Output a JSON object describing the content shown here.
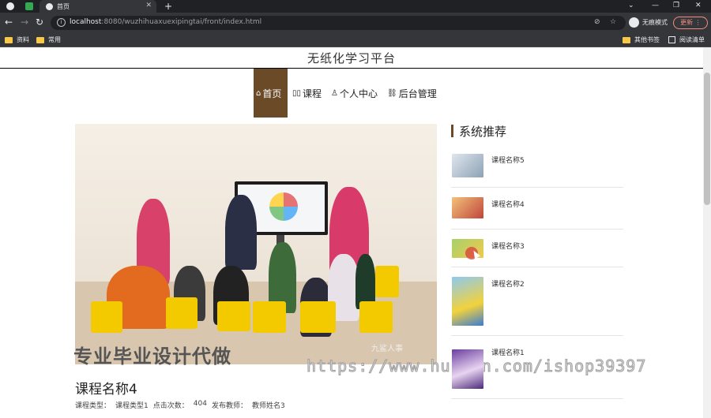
{
  "browser": {
    "tab_title": "首页",
    "url_host": "localhost",
    "url_rest": ":8080/wuzhihuaxuexipingtai/front/index.html",
    "profile_label": "无痕模式",
    "update_label": "更新",
    "bookmarks": [
      "资料",
      "常用"
    ],
    "other_bookmarks": "其他书签",
    "reading_list": "阅读清单"
  },
  "site": {
    "title": "无纸化学习平台",
    "menu": [
      {
        "label": "首页",
        "icon": "home-icon"
      },
      {
        "label": "课程",
        "icon": "book-icon"
      },
      {
        "label": "个人中心",
        "icon": "user-icon"
      },
      {
        "label": "后台管理",
        "icon": "link-icon"
      }
    ]
  },
  "hero": {
    "caption": "专业毕业设计代做",
    "watermark_corner": "九鲨人事",
    "watermark_url": "https://www.huzhan.com/ishop39397"
  },
  "course": {
    "title": "课程名称4",
    "type_label": "课程类型：",
    "type_value": "课程类型1",
    "clicks_label": "点击次数：",
    "clicks_value": "404",
    "teacher_label": "发布教师：",
    "teacher_value": "教师姓名3"
  },
  "recommend": {
    "title": "系统推荐",
    "items": [
      {
        "name": "课程名称5"
      },
      {
        "name": "课程名称4"
      },
      {
        "name": "课程名称3"
      },
      {
        "name": "课程名称2"
      },
      {
        "name": "课程名称1"
      }
    ]
  },
  "colors": {
    "accent": "#6b4a27",
    "chrome_dark": "#202124",
    "chrome": "#35363a"
  }
}
